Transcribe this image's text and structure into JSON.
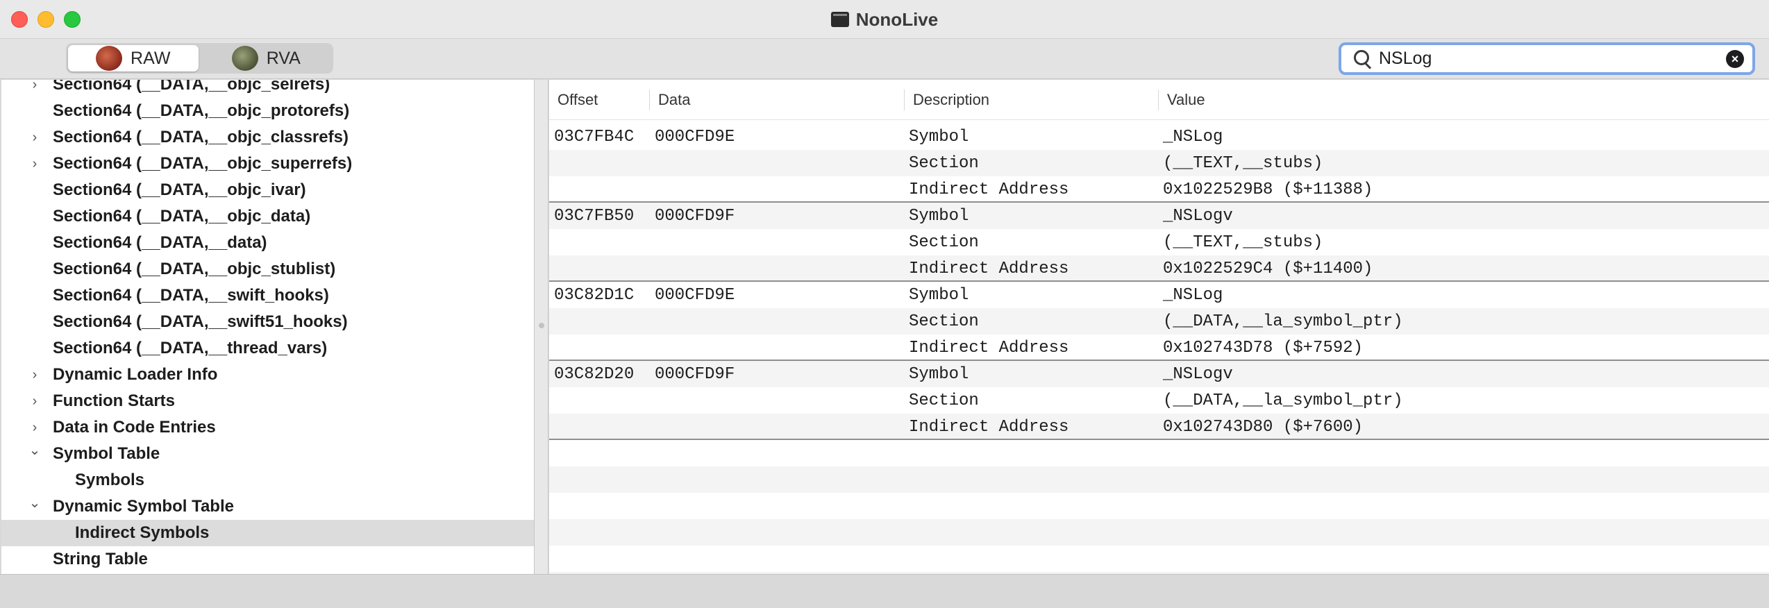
{
  "window": {
    "title": "NonoLive"
  },
  "toolbar": {
    "segments": [
      {
        "label": "RAW",
        "active": true,
        "icon": "raw-icon"
      },
      {
        "label": "RVA",
        "active": false,
        "icon": "rva-icon"
      }
    ],
    "search": {
      "value": "NSLog",
      "placeholder": ""
    }
  },
  "outline": {
    "items": [
      {
        "label": "Section64 (__DATA,__objc_selrefs)",
        "indent": 1,
        "chevron": "right"
      },
      {
        "label": "Section64 (__DATA,__objc_protorefs)",
        "indent": 1,
        "chevron": ""
      },
      {
        "label": "Section64 (__DATA,__objc_classrefs)",
        "indent": 1,
        "chevron": "right"
      },
      {
        "label": "Section64 (__DATA,__objc_superrefs)",
        "indent": 1,
        "chevron": "right"
      },
      {
        "label": "Section64 (__DATA,__objc_ivar)",
        "indent": 1,
        "chevron": ""
      },
      {
        "label": "Section64 (__DATA,__objc_data)",
        "indent": 1,
        "chevron": ""
      },
      {
        "label": "Section64 (__DATA,__data)",
        "indent": 1,
        "chevron": ""
      },
      {
        "label": "Section64 (__DATA,__objc_stublist)",
        "indent": 1,
        "chevron": ""
      },
      {
        "label": "Section64 (__DATA,__swift_hooks)",
        "indent": 1,
        "chevron": ""
      },
      {
        "label": "Section64 (__DATA,__swift51_hooks)",
        "indent": 1,
        "chevron": ""
      },
      {
        "label": "Section64 (__DATA,__thread_vars)",
        "indent": 1,
        "chevron": ""
      },
      {
        "label": "Dynamic Loader Info",
        "indent": 1,
        "chevron": "right"
      },
      {
        "label": "Function Starts",
        "indent": 1,
        "chevron": "right"
      },
      {
        "label": "Data in Code Entries",
        "indent": 1,
        "chevron": "right"
      },
      {
        "label": "Symbol Table",
        "indent": 1,
        "chevron": "down"
      },
      {
        "label": "Symbols",
        "indent": 2,
        "chevron": ""
      },
      {
        "label": "Dynamic Symbol Table",
        "indent": 1,
        "chevron": "down"
      },
      {
        "label": "Indirect Symbols",
        "indent": 2,
        "chevron": "",
        "selected": true
      },
      {
        "label": "String Table",
        "indent": 1,
        "chevron": ""
      }
    ]
  },
  "table": {
    "headers": [
      "Offset",
      "Data",
      "Description",
      "Value"
    ],
    "rows": [
      {
        "offset": "03C7FB4C",
        "data": "000CFD9E",
        "description": "Symbol",
        "value": "_NSLog"
      },
      {
        "offset": "",
        "data": "",
        "description": "Section",
        "value": "(__TEXT,__stubs)"
      },
      {
        "offset": "",
        "data": "",
        "description": "Indirect Address",
        "value": "0x1022529B8 ($+11388)"
      },
      {
        "offset": "03C7FB50",
        "data": "000CFD9F",
        "description": "Symbol",
        "value": "_NSLogv"
      },
      {
        "offset": "",
        "data": "",
        "description": "Section",
        "value": "(__TEXT,__stubs)"
      },
      {
        "offset": "",
        "data": "",
        "description": "Indirect Address",
        "value": "0x1022529C4 ($+11400)"
      },
      {
        "offset": "03C82D1C",
        "data": "000CFD9E",
        "description": "Symbol",
        "value": "_NSLog"
      },
      {
        "offset": "",
        "data": "",
        "description": "Section",
        "value": "(__DATA,__la_symbol_ptr)"
      },
      {
        "offset": "",
        "data": "",
        "description": "Indirect Address",
        "value": "0x102743D78 ($+7592)"
      },
      {
        "offset": "03C82D20",
        "data": "000CFD9F",
        "description": "Symbol",
        "value": "_NSLogv"
      },
      {
        "offset": "",
        "data": "",
        "description": "Section",
        "value": "(__DATA,__la_symbol_ptr)"
      },
      {
        "offset": "",
        "data": "",
        "description": "Indirect Address",
        "value": "0x102743D80 ($+7600)"
      }
    ]
  }
}
